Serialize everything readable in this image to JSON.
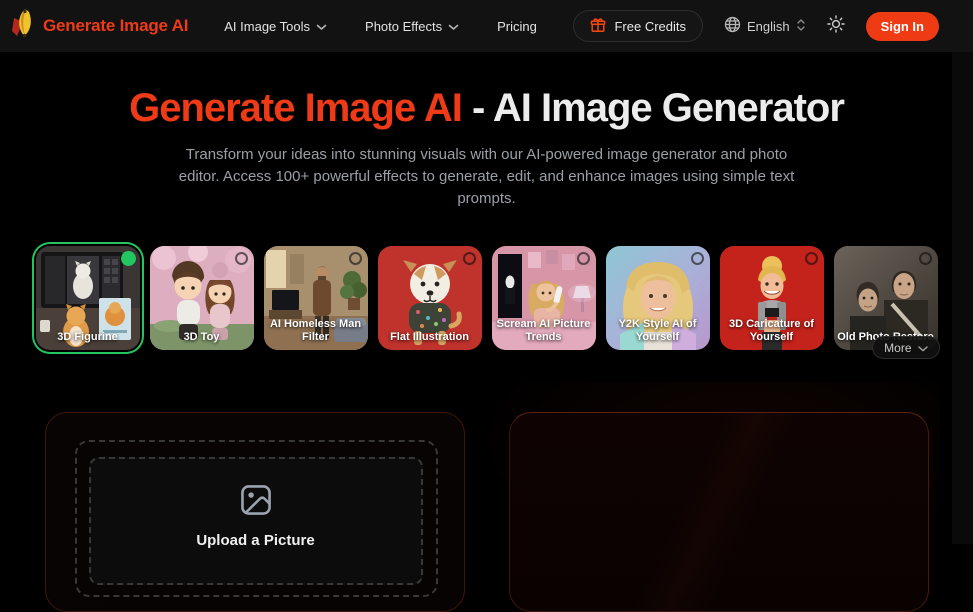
{
  "navbar": {
    "brand": "Generate Image AI",
    "links": [
      {
        "label": "AI Image Tools",
        "has_dropdown": true
      },
      {
        "label": "Photo Effects",
        "has_dropdown": true
      },
      {
        "label": "Pricing",
        "has_dropdown": false
      }
    ],
    "free_credits_label": "Free Credits",
    "language": "English",
    "sign_in_label": "Sign In"
  },
  "hero": {
    "title_highlight": "Generate Image AI",
    "title_rest": " - AI Image Generator",
    "subtitle": "Transform your ideas into stunning visuals with our AI-powered image generator and photo editor. Access 100+ powerful effects to generate, edit, and enhance images using simple text prompts."
  },
  "effects": {
    "cards": [
      {
        "label": "3D Figurine",
        "selected": true
      },
      {
        "label": "3D Toy",
        "selected": false
      },
      {
        "label": "AI Homeless Man Filter",
        "selected": false
      },
      {
        "label": "Flat Illustration",
        "selected": false
      },
      {
        "label": "Scream AI Picture Trends",
        "selected": false
      },
      {
        "label": "Y2K Style AI of Yourself",
        "selected": false
      },
      {
        "label": "3D Caricature of Yourself",
        "selected": false
      },
      {
        "label": "Old Photo Restore",
        "selected": false
      }
    ],
    "more_label": "More"
  },
  "uploader": {
    "label": "Upload a Picture"
  },
  "colors": {
    "accent": "#ee3a17",
    "selected_green": "#22c55e",
    "navbar_bg": "#121212",
    "page_bg": "#000000"
  }
}
